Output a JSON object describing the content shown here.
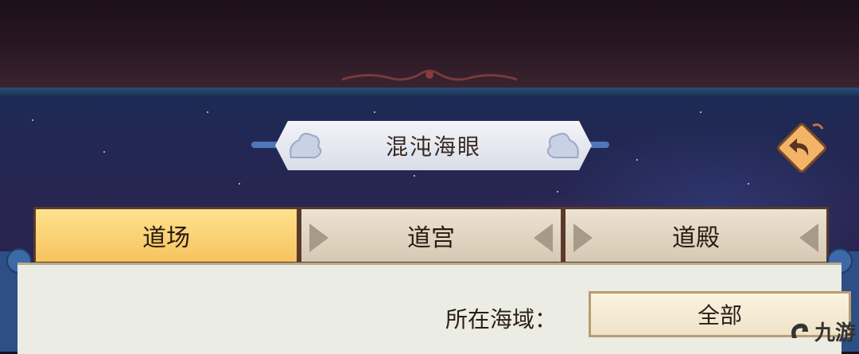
{
  "header": {
    "title": "混沌海眼"
  },
  "back_button": {
    "icon": "back-arrow-icon"
  },
  "tabs": [
    {
      "label": "道场",
      "active": true
    },
    {
      "label": "道宫",
      "active": false
    },
    {
      "label": "道殿",
      "active": false
    }
  ],
  "filter": {
    "label": "所在海域：",
    "selected_value": "全部"
  },
  "watermark": {
    "text": "九游"
  },
  "colors": {
    "active_tab": "#f6c35e",
    "inactive_tab": "#d7c8b2",
    "frame_blue": "#2d4f86",
    "back_button": "#f3b46a"
  }
}
